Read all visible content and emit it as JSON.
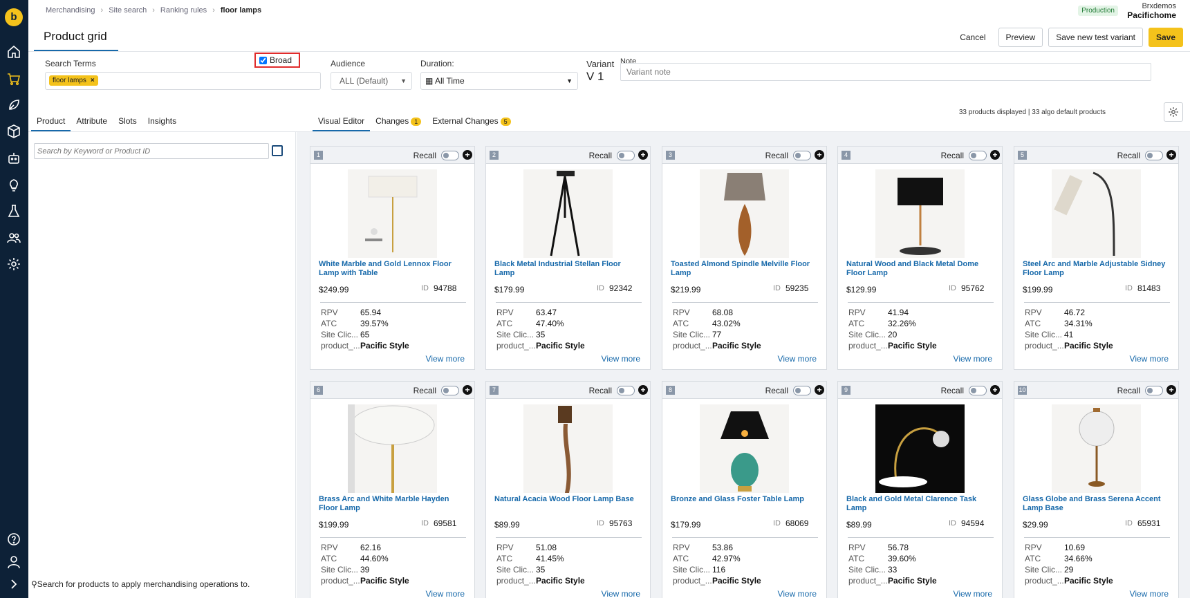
{
  "logo": "b",
  "breadcrumbs": [
    "Merchandising",
    "Site search",
    "Ranking rules",
    "floor lamps"
  ],
  "page_title": "Product grid",
  "account": {
    "org": "Brxdemos",
    "site": "Pacifichome",
    "env": "Production"
  },
  "actions": {
    "cancel": "Cancel",
    "preview": "Preview",
    "save_variant": "Save new test variant",
    "save": "Save"
  },
  "filters": {
    "search_terms_label": "Search Terms",
    "term_chip": "floor lamps",
    "broad_label": "Broad",
    "audience_label": "Audience",
    "audience_value": "ALL (Default)",
    "duration_label": "Duration:",
    "duration_value": "All Time",
    "variant_label": "Variant",
    "variant_value": "V 1",
    "note_label": "Note",
    "note_placeholder": "Variant note"
  },
  "left_tabs": [
    "Product",
    "Attribute",
    "Slots",
    "Insights"
  ],
  "right_tabs": [
    {
      "label": "Visual Editor",
      "badge": ""
    },
    {
      "label": "Changes",
      "badge": "1"
    },
    {
      "label": "External Changes",
      "badge": "5"
    }
  ],
  "counts_text": "33 products displayed | 33 algo default products",
  "search": {
    "placeholder": "Search by Keyword or Product ID"
  },
  "empty_message": "Search for products to apply merchandising operations to.",
  "card_labels": {
    "recall": "Recall",
    "id": "ID",
    "rpv": "RPV",
    "atc": "ATC",
    "site_clicks": "Site Clic...",
    "product_attr": "product_...",
    "view_more": "View more"
  },
  "products": [
    {
      "rank": "1",
      "name": "White Marble and Gold Lennox Floor Lamp with Table",
      "price": "$249.99",
      "id": "94788",
      "rpv": "65.94",
      "atc": "39.57%",
      "clicks": "65",
      "style": "Pacific Style"
    },
    {
      "rank": "2",
      "name": "Black Metal Industrial Stellan Floor Lamp",
      "price": "$179.99",
      "id": "92342",
      "rpv": "63.47",
      "atc": "47.40%",
      "clicks": "35",
      "style": "Pacific Style"
    },
    {
      "rank": "3",
      "name": "Toasted Almond Spindle Melville Floor Lamp",
      "price": "$219.99",
      "id": "59235",
      "rpv": "68.08",
      "atc": "43.02%",
      "clicks": "77",
      "style": "Pacific Style"
    },
    {
      "rank": "4",
      "name": "Natural Wood and Black Metal Dome Floor Lamp",
      "price": "$129.99",
      "id": "95762",
      "rpv": "41.94",
      "atc": "32.26%",
      "clicks": "20",
      "style": "Pacific Style"
    },
    {
      "rank": "5",
      "name": "Steel Arc and Marble Adjustable Sidney Floor Lamp",
      "price": "$199.99",
      "id": "81483",
      "rpv": "46.72",
      "atc": "34.31%",
      "clicks": "41",
      "style": "Pacific Style"
    },
    {
      "rank": "6",
      "name": "Brass Arc and White Marble Hayden Floor Lamp",
      "price": "$199.99",
      "id": "69581",
      "rpv": "62.16",
      "atc": "44.60%",
      "clicks": "39",
      "style": "Pacific Style"
    },
    {
      "rank": "7",
      "name": "Natural Acacia Wood Floor Lamp Base",
      "price": "$89.99",
      "id": "95763",
      "rpv": "51.08",
      "atc": "41.45%",
      "clicks": "35",
      "style": "Pacific Style"
    },
    {
      "rank": "8",
      "name": "Bronze and Glass Foster Table Lamp",
      "price": "$179.99",
      "id": "68069",
      "rpv": "53.86",
      "atc": "42.97%",
      "clicks": "116",
      "style": "Pacific Style"
    },
    {
      "rank": "9",
      "name": "Black and Gold Metal Clarence Task Lamp",
      "price": "$89.99",
      "id": "94594",
      "rpv": "56.78",
      "atc": "39.60%",
      "clicks": "33",
      "style": "Pacific Style"
    },
    {
      "rank": "10",
      "name": "Glass Globe and Brass Serena Accent Lamp Base",
      "price": "$29.99",
      "id": "65931",
      "rpv": "10.69",
      "atc": "34.66%",
      "clicks": "29",
      "style": "Pacific Style"
    }
  ],
  "colors": {
    "nav_bg": "#0d2137",
    "accent": "#f4c21b",
    "link": "#1769aa",
    "highlight": "#e02b2b"
  }
}
